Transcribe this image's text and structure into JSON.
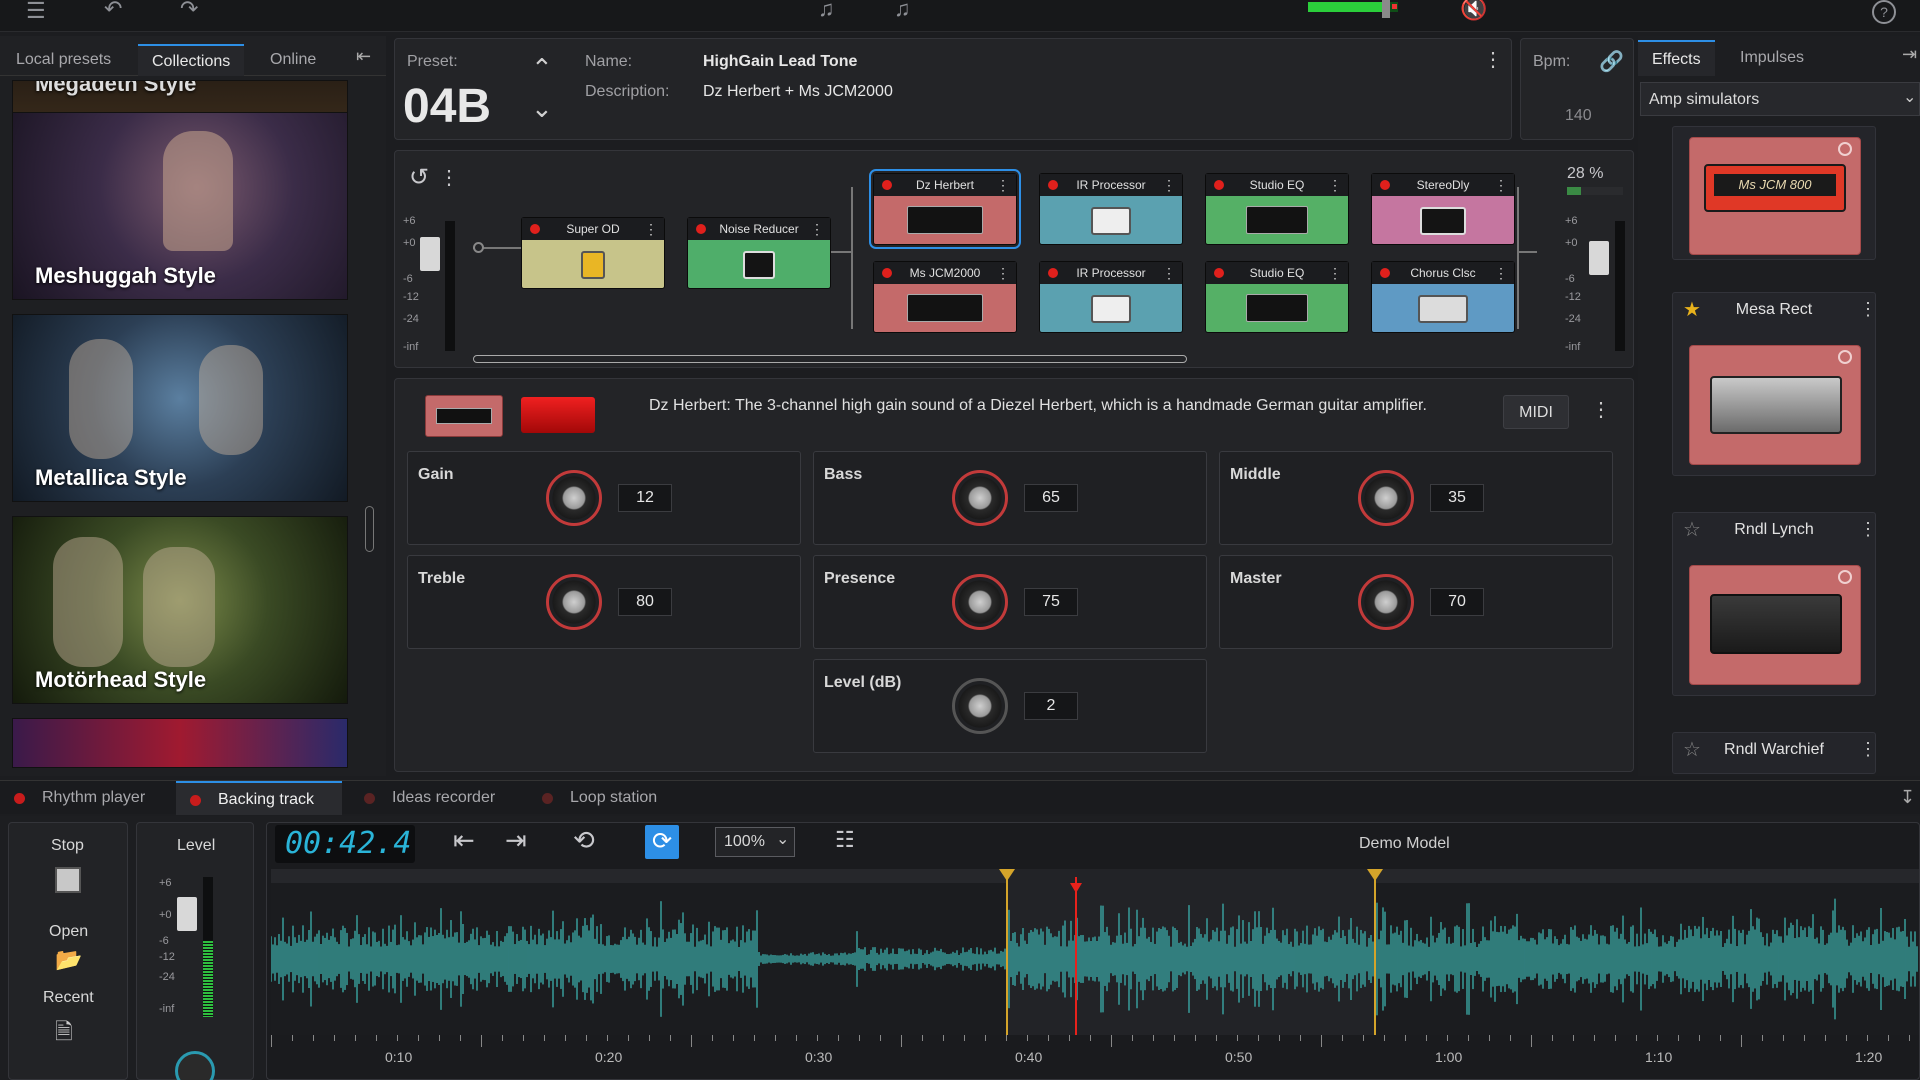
{
  "topbar": {
    "icons": [
      "menu-icon",
      "undo-icon",
      "redo-icon",
      "tuner-icon",
      "metronome-icon",
      "mute-icon",
      "help-icon"
    ]
  },
  "left": {
    "tabs": [
      "Local presets",
      "Collections",
      "Online"
    ],
    "collapse_icon": "collapse-left-icon",
    "cards": [
      "Megadeth Style",
      "Meshuggah Style",
      "Metallica Style",
      "Motörhead Style"
    ]
  },
  "preset": {
    "label": "Preset:",
    "number": "04B",
    "name_label": "Name:",
    "name": "HighGain Lead Tone",
    "desc_label": "Description:",
    "description": "Dz Herbert + Ms JCM2000",
    "bpm_label": "Bpm:",
    "bpm": "140"
  },
  "chain": {
    "input_meter": [
      "+6",
      "+0",
      "-6",
      "-12",
      "-24",
      "-inf"
    ],
    "output_meter": [
      "+6",
      "+0",
      "-6",
      "-12",
      "-24",
      "-inf"
    ],
    "output_percent": "28 %",
    "pedals": {
      "super_od": "Super OD",
      "noise_reducer": "Noise Reducer",
      "dz_herbert": "Dz Herbert",
      "ir1": "IR Processor",
      "eq1": "Studio EQ",
      "stereodly": "StereoDly",
      "ms_jcm2000": "Ms JCM2000",
      "ir2": "IR Processor",
      "eq2": "Studio EQ",
      "chorus": "Chorus Clsc"
    }
  },
  "editor": {
    "description": "Dz Herbert:  The 3-channel high gain sound of a Diezel Herbert, which is a handmade German guitar amplifier.",
    "midi": "MIDI",
    "knobs": {
      "gain": {
        "label": "Gain",
        "value": "12"
      },
      "bass": {
        "label": "Bass",
        "value": "65"
      },
      "middle": {
        "label": "Middle",
        "value": "35"
      },
      "treble": {
        "label": "Treble",
        "value": "80"
      },
      "presence": {
        "label": "Presence",
        "value": "75"
      },
      "master": {
        "label": "Master",
        "value": "70"
      },
      "level": {
        "label": "Level (dB)",
        "value": "2"
      }
    }
  },
  "right": {
    "tabs": [
      "Effects",
      "Impulses"
    ],
    "category": "Amp simulators",
    "first_amp_badge": "Ms JCM 800",
    "amps": [
      "Mesa Rect",
      "Rndl Lynch",
      "Rndl Warchief"
    ]
  },
  "bottom": {
    "tabs": [
      "Rhythm player",
      "Backing track",
      "Ideas recorder",
      "Loop station"
    ],
    "stop": "Stop",
    "open": "Open",
    "recent": "Recent",
    "level": "Level",
    "level_meter": [
      "+6",
      "+0",
      "-6",
      "-12",
      "-24",
      "-inf"
    ],
    "time": "00:42.4",
    "zoom": "100%",
    "track_name": "Demo Model",
    "ruler": [
      "0:10",
      "0:20",
      "0:30",
      "0:40",
      "0:50",
      "1:00",
      "1:10",
      "1:20"
    ]
  },
  "colors": {
    "accent": "#2d8fe6",
    "wave": "#3aa6a3",
    "led": "#e0201c",
    "loop_marker": "#d4a42a",
    "playhead": "#e8221c"
  }
}
